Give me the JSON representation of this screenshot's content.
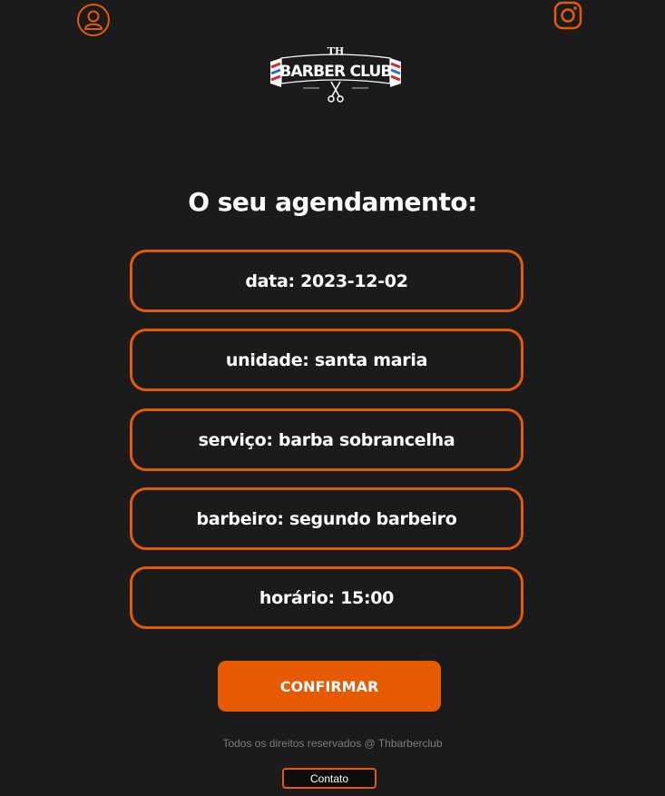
{
  "colors": {
    "background": "#1c1b1b",
    "accent": "#e45a0c",
    "button": "#e65a04",
    "footer_text": "#7d7b78"
  },
  "header": {
    "profile_icon": "user-profile-icon",
    "instagram_icon": "instagram-icon",
    "logo": {
      "top_text": "TH",
      "main_text": "BARBER CLUB",
      "emblem": "scissors-icon"
    }
  },
  "main": {
    "title": "O seu agendamento:",
    "details": {
      "data": "data: 2023-12-02",
      "unidade": "unidade: santa maria",
      "servico": "serviço: barba sobrancelha",
      "barbeiro": "barbeiro: segundo barbeiro",
      "horario": "horário: 15:00"
    },
    "confirm_label": "CONFIRMAR"
  },
  "footer": {
    "copyright": "Todos os direitos reservados @ Thbarberclub",
    "contact_label": "Contato"
  }
}
